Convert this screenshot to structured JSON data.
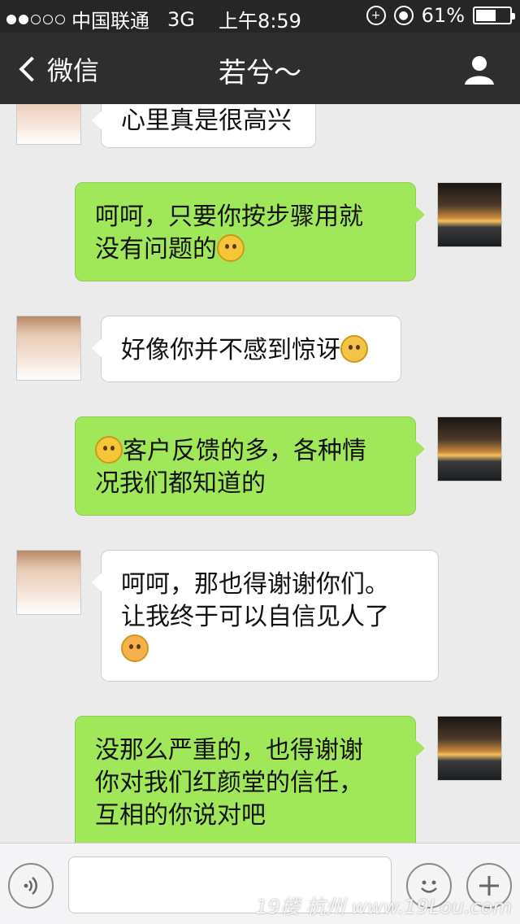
{
  "status": {
    "carrier": "中国联通",
    "network": "3G",
    "time": "上午8:59",
    "battery": "61%",
    "battery_level": 0.61
  },
  "nav": {
    "back_label": "微信",
    "title": "若兮～"
  },
  "messages": [
    {
      "side": "left",
      "avatar": "female-avatar",
      "text": "心里真是很高兴"
    },
    {
      "side": "right",
      "avatar": "sunset-avatar",
      "line1": "呵呵，只要你按步骤用就",
      "line2": "没有问题的",
      "emoji": "smile-emoji"
    },
    {
      "side": "left",
      "avatar": "female-avatar",
      "text": "好像你并不感到惊讶",
      "emoji": "worried-emoji"
    },
    {
      "side": "right",
      "avatar": "sunset-avatar",
      "emoji": "smile-emoji",
      "line1": "客户反馈的多，各种情",
      "line2": "况我们都知道的"
    },
    {
      "side": "left",
      "avatar": "female-avatar",
      "line1": "呵呵，那也得谢谢你们。",
      "line2": "让我终于可以自信见人了",
      "emoji": "blush-emoji"
    },
    {
      "side": "right",
      "avatar": "sunset-avatar",
      "line1": "没那么严重的，也得谢谢",
      "line2": "你对我们红颜堂的信任，",
      "line3": "互相的你说对吧"
    }
  ],
  "input": {
    "placeholder": ""
  },
  "watermark": "19楼 杭州 www.19Lou.com"
}
